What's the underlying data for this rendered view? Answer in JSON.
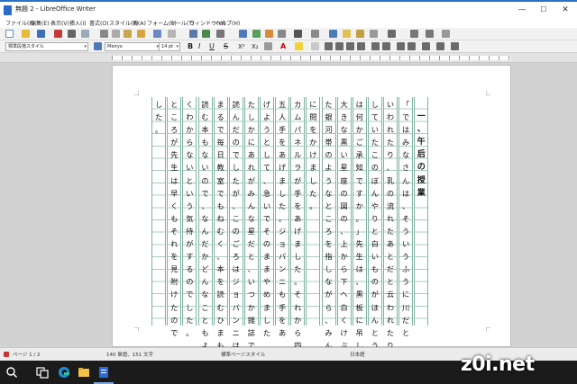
{
  "window": {
    "title": "無題 2 - LibreOffice Writer",
    "controls": [
      "—",
      "☐",
      "✕"
    ]
  },
  "menu": [
    "ファイル(F)",
    "編集(E)",
    "表示(V)",
    "挿入(I)",
    "書式(O)",
    "スタイル(Y)",
    "表(A)",
    "フォーム(R)",
    "ツール(T)",
    "ウィンドウ(W)",
    "ヘルプ(H)"
  ],
  "format_bar": {
    "paragraph_style": "標準段落スタイル",
    "font_name": "Meiryo",
    "font_size": "14 pt",
    "bold": "B",
    "italic": "I",
    "underline": "U",
    "strike": "S",
    "superscript": "X²",
    "subscript": "X₂",
    "font_color_letter": "A"
  },
  "document": {
    "columns": [
      [
        "",
        "一",
        "、",
        "午",
        "后",
        "の",
        "授",
        "業",
        "",
        "",
        "",
        "",
        "",
        "",
        "",
        "",
        "",
        ""
      ],
      [
        "「",
        "で",
        "は",
        "み",
        "な",
        "さ",
        "ん",
        "は",
        "、",
        "そ",
        "う",
        "い",
        "う",
        "ふ",
        "う",
        "に",
        "川",
        "だ",
        "と"
      ],
      [
        "い",
        "わ",
        "れ",
        "た",
        "り",
        "、",
        "乳",
        "の",
        "流",
        "れ",
        "た",
        "あ",
        "と",
        "だ",
        "と",
        "云",
        "わ",
        "れ",
        "た",
        "り"
      ],
      [
        "し",
        "て",
        "い",
        "た",
        "こ",
        "の",
        "ぼ",
        "ん",
        "や",
        "り",
        "と",
        "白",
        "い",
        "も",
        "の",
        "が",
        "ほ",
        "ん",
        "と",
        "う"
      ],
      [
        "は",
        "何",
        "か",
        "ご",
        "承",
        "知",
        "で",
        "す",
        "か",
        "。",
        "」",
        "先",
        "生",
        "は",
        "、",
        "黒",
        "板",
        "に",
        "吊",
        "し",
        "た"
      ],
      [
        "大",
        "き",
        "な",
        "黒",
        "い",
        "星",
        "座",
        "の",
        "図",
        "の",
        "、",
        "上",
        "か",
        "ら",
        "下",
        "へ",
        "白",
        "く",
        "け",
        "ぶ",
        "つ"
      ],
      [
        "た",
        "銀",
        "河",
        "帯",
        "の",
        "よ",
        "う",
        "な",
        "と",
        "こ",
        "ろ",
        "を",
        "指",
        "し",
        "な",
        "が",
        "ら",
        "、",
        "み",
        "ん",
        "な"
      ],
      [
        "に",
        "問",
        "を",
        "か",
        "け",
        "ま",
        "し",
        "た",
        "。",
        "",
        "",
        "",
        "",
        "",
        "",
        "",
        "",
        "",
        "",
        ""
      ],
      [
        "カ",
        "ム",
        "パ",
        "ネ",
        "ル",
        "ラ",
        "が",
        "手",
        "を",
        "あ",
        "げ",
        "ま",
        "し",
        "た",
        "。",
        "そ",
        "れ",
        "か",
        "ら",
        "四"
      ],
      [
        "五",
        "人",
        "手",
        "を",
        "あ",
        "げ",
        "ま",
        "し",
        "た",
        "。",
        "ジ",
        "ョ",
        "バ",
        "ン",
        "ニ",
        "も",
        "手",
        "を",
        "あ"
      ],
      [
        "げ",
        "よ",
        "う",
        "と",
        "し",
        "て",
        "、",
        "急",
        "い",
        "で",
        "そ",
        "の",
        "ま",
        "ま",
        "や",
        "め",
        "ま",
        "し",
        "た"
      ],
      [
        "た",
        "し",
        "か",
        "に",
        "あ",
        "れ",
        "が",
        "み",
        "ん",
        "な",
        "星",
        "だ",
        "と",
        "、",
        "い",
        "つ",
        "か",
        "雑",
        "誌",
        "で"
      ],
      [
        "読",
        "ん",
        "だ",
        "の",
        "で",
        "し",
        "た",
        "が",
        "、",
        "こ",
        "の",
        "ご",
        "ろ",
        "は",
        "ジ",
        "ョ",
        "バ",
        "ン",
        "ニ",
        "は"
      ],
      [
        "ま",
        "る",
        "で",
        "毎",
        "日",
        "教",
        "室",
        "で",
        "も",
        "ね",
        "む",
        "く",
        "、",
        "本",
        "を",
        "読",
        "む",
        "ひ",
        "ま",
        "も"
      ],
      [
        "読",
        "む",
        "本",
        "も",
        "な",
        "い",
        "の",
        "で",
        "、",
        "な",
        "ん",
        "だ",
        "か",
        "ど",
        "ん",
        "な",
        "こ",
        "と",
        "も",
        "よ"
      ],
      [
        "く",
        "わ",
        "か",
        "ら",
        "な",
        "い",
        "と",
        "い",
        "う",
        "気",
        "持",
        "が",
        "す",
        "る",
        "の",
        "で",
        "し",
        "た",
        "。",
        ""
      ],
      [
        "と",
        "こ",
        "ろ",
        "が",
        "先",
        "生",
        "は",
        "早",
        "く",
        "も",
        "そ",
        "れ",
        "を",
        "見",
        "附",
        "け",
        "た",
        "の",
        "で"
      ],
      [
        "し",
        "た",
        "。",
        "",
        "",
        "",
        "",
        "",
        "",
        "",
        "",
        "",
        "",
        "",
        "",
        "",
        "",
        "",
        ""
      ]
    ]
  },
  "status": {
    "page": "ページ 1 / 2",
    "count": "140 単語、151 文字",
    "page_style": "標準ページスタイル",
    "language": "日本語"
  },
  "watermark": "z0i.net"
}
